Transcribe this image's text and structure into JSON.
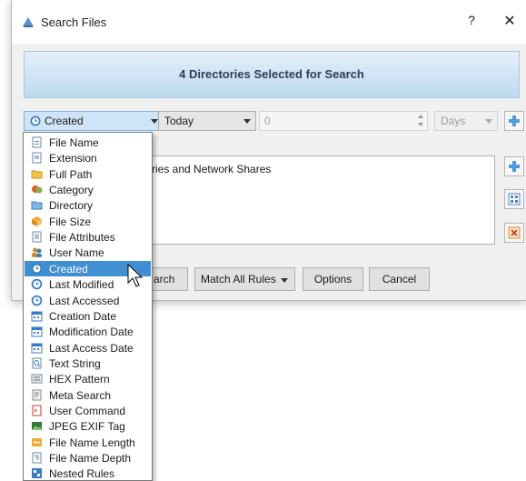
{
  "window": {
    "title": "Search Files",
    "help_label": "?",
    "close_label": "✕"
  },
  "banner": {
    "text": "4 Directories Selected for Search"
  },
  "rule": {
    "property": "Created",
    "comparison": "Today",
    "value": "0",
    "unit": "Days"
  },
  "directories": {
    "row_text": "ries and Network Shares"
  },
  "buttons": {
    "search": "arch",
    "match": "Match All Rules",
    "options": "Options",
    "cancel": "Cancel"
  },
  "dropdown": {
    "selected_index": 8,
    "items": [
      {
        "label": "File Name",
        "icon": "file-name-icon"
      },
      {
        "label": "Extension",
        "icon": "extension-icon"
      },
      {
        "label": "Full Path",
        "icon": "folder-icon"
      },
      {
        "label": "Category",
        "icon": "category-icon"
      },
      {
        "label": "Directory",
        "icon": "directory-icon"
      },
      {
        "label": "File Size",
        "icon": "file-size-icon"
      },
      {
        "label": "File Attributes",
        "icon": "file-attributes-icon"
      },
      {
        "label": "User Name",
        "icon": "user-icon"
      },
      {
        "label": "Created",
        "icon": "clock-icon"
      },
      {
        "label": "Last Modified",
        "icon": "clock-icon"
      },
      {
        "label": "Last Accessed",
        "icon": "clock-icon"
      },
      {
        "label": "Creation Date",
        "icon": "calendar-icon"
      },
      {
        "label": "Modification Date",
        "icon": "calendar-icon"
      },
      {
        "label": "Last Access Date",
        "icon": "calendar-icon"
      },
      {
        "label": "Text String",
        "icon": "text-search-icon"
      },
      {
        "label": "HEX Pattern",
        "icon": "hex-icon"
      },
      {
        "label": "Meta Search",
        "icon": "meta-icon"
      },
      {
        "label": "User Command",
        "icon": "command-icon"
      },
      {
        "label": "JPEG EXIF Tag",
        "icon": "image-icon"
      },
      {
        "label": "File Name Length",
        "icon": "length-icon"
      },
      {
        "label": "File Name Depth",
        "icon": "depth-icon"
      },
      {
        "label": "Nested Rules",
        "icon": "nested-icon"
      }
    ]
  },
  "colors": {
    "selection": "#3f8fd2",
    "banner_text": "#2c3e50"
  }
}
